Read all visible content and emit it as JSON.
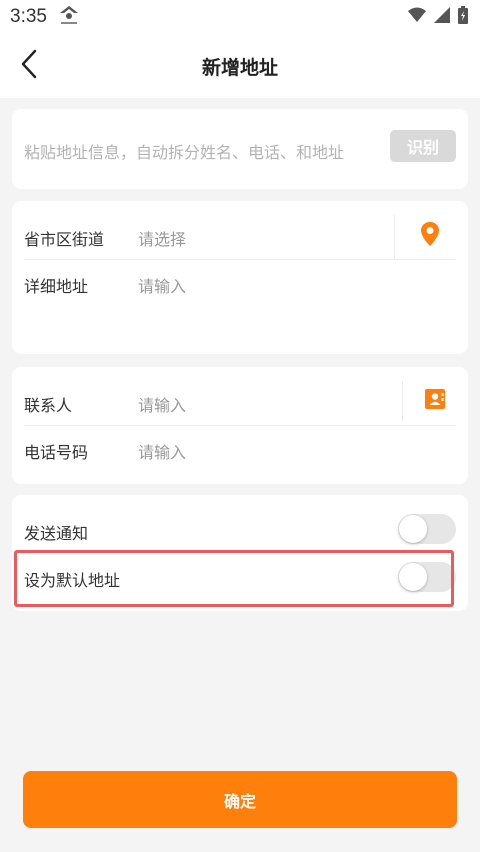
{
  "status_bar": {
    "time": "3:35",
    "icons": [
      "app-logo-icon",
      "wifi-icon",
      "signal-icon",
      "battery-icon"
    ]
  },
  "header": {
    "title": "新增地址"
  },
  "paste_card": {
    "placeholder": "粘贴地址信息，自动拆分姓名、电话、和地址",
    "identify_label": "识别"
  },
  "address_card": {
    "region_label": "省市区街道",
    "region_placeholder": "请选择",
    "detail_label": "详细地址",
    "detail_placeholder": "请输入"
  },
  "contact_card": {
    "name_label": "联系人",
    "name_placeholder": "请输入",
    "phone_label": "电话号码",
    "phone_placeholder": "请输入"
  },
  "settings_card": {
    "notify_label": "发送通知",
    "notify_on": false,
    "default_label": "设为默认地址",
    "default_on": false
  },
  "footer": {
    "confirm_label": "确定"
  },
  "colors": {
    "accent": "#fe7f0c",
    "highlight": "#e95b5d",
    "placeholder": "#999999"
  }
}
